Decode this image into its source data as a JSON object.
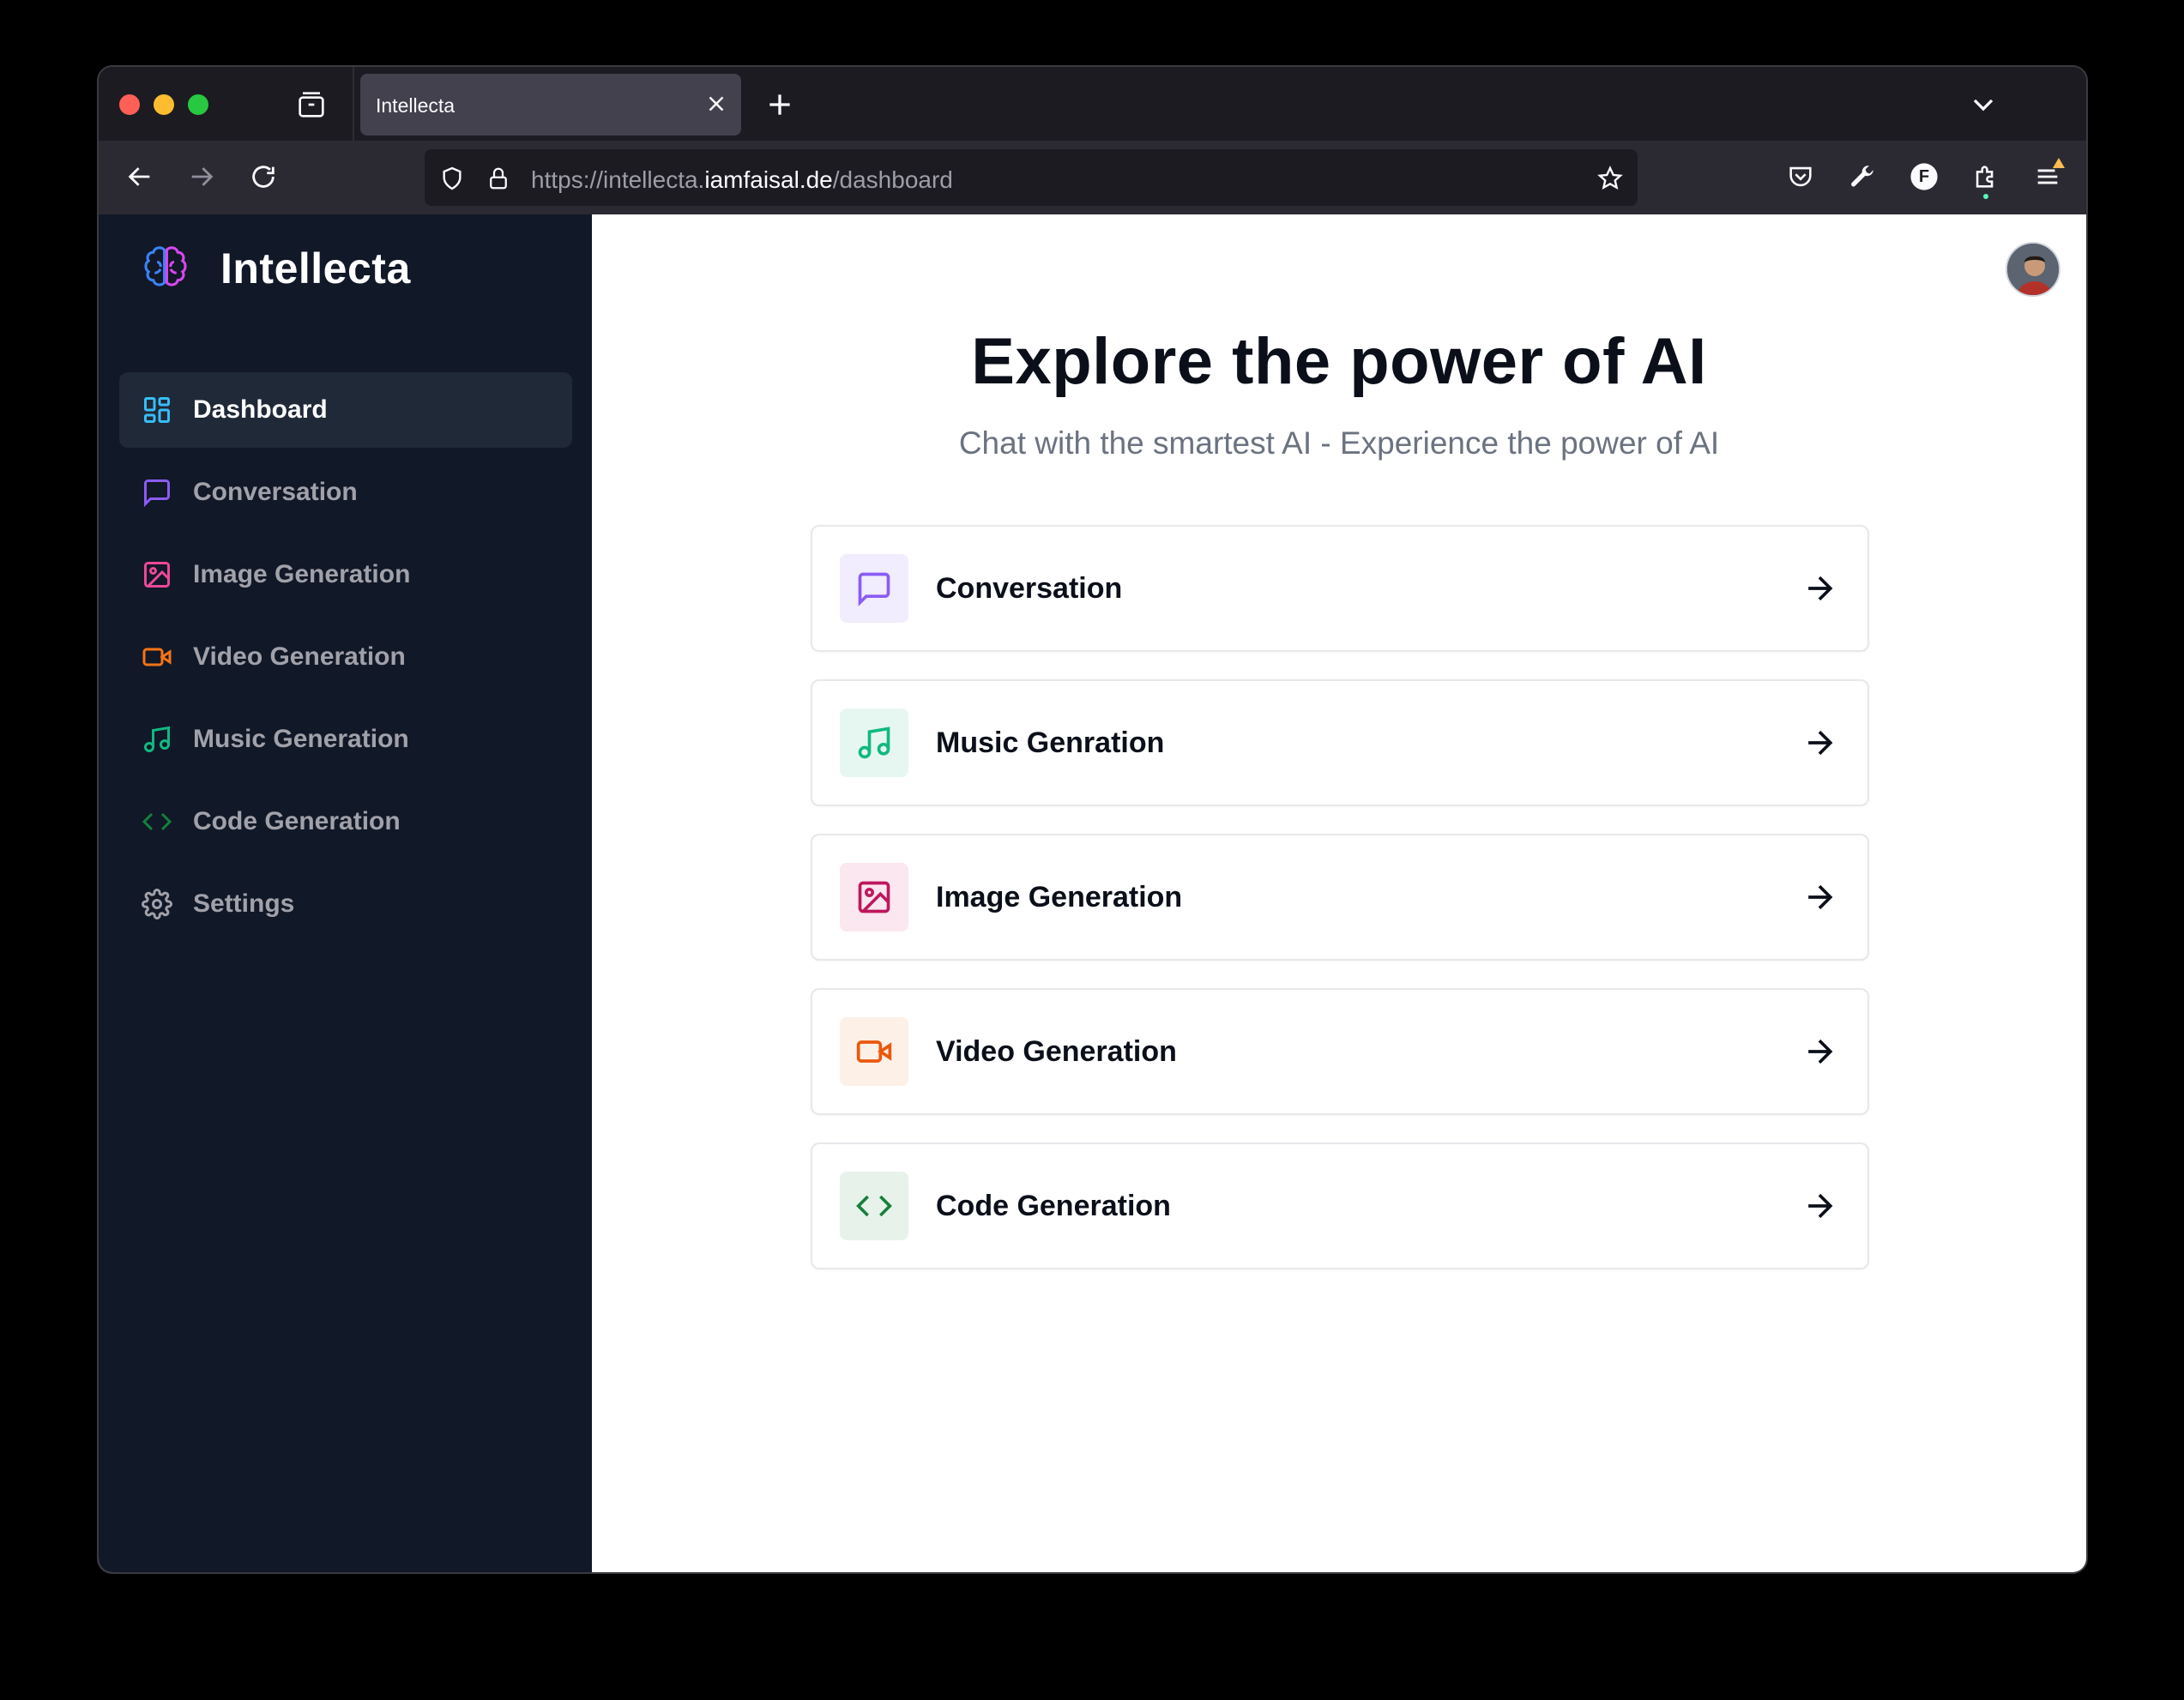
{
  "browser": {
    "tab_title": "Intellecta",
    "url": {
      "prefix": "https://intellecta.",
      "host": "iamfaisal.de",
      "path": "/dashboard"
    },
    "profile_initial": "F"
  },
  "sidebar": {
    "brand": "Intellecta",
    "items": [
      {
        "label": "Dashboard",
        "icon": "dashboard-icon",
        "color": "#38bdf8",
        "active": true
      },
      {
        "label": "Conversation",
        "icon": "message-square-icon",
        "color": "#8b5cf6"
      },
      {
        "label": "Image Generation",
        "icon": "image-icon",
        "color": "#ec4899"
      },
      {
        "label": "Video Generation",
        "icon": "video-icon",
        "color": "#f97316"
      },
      {
        "label": "Music Generation",
        "icon": "music-icon",
        "color": "#10b981"
      },
      {
        "label": "Code Generation",
        "icon": "code-icon",
        "color": "#15803d"
      },
      {
        "label": "Settings",
        "icon": "settings-icon",
        "color": "#a1a1aa"
      }
    ]
  },
  "main": {
    "title": "Explore the power of AI",
    "subtitle": "Chat with the smartest AI - Experience the power of AI",
    "cards": [
      {
        "label": "Conversation",
        "icon": "message-square-icon",
        "color": "#8b5cf6",
        "bg": "#f1ecfe"
      },
      {
        "label": "Music Genration",
        "icon": "music-icon",
        "color": "#10b981",
        "bg": "#e6f7f1"
      },
      {
        "label": "Image Generation",
        "icon": "image-icon",
        "color": "#be185d",
        "bg": "#fbe7ef"
      },
      {
        "label": "Video Generation",
        "icon": "video-icon",
        "color": "#ea580c",
        "bg": "#fdf0e7"
      },
      {
        "label": "Code Generation",
        "icon": "code-icon",
        "color": "#15803d",
        "bg": "#e7f3ea"
      }
    ]
  }
}
